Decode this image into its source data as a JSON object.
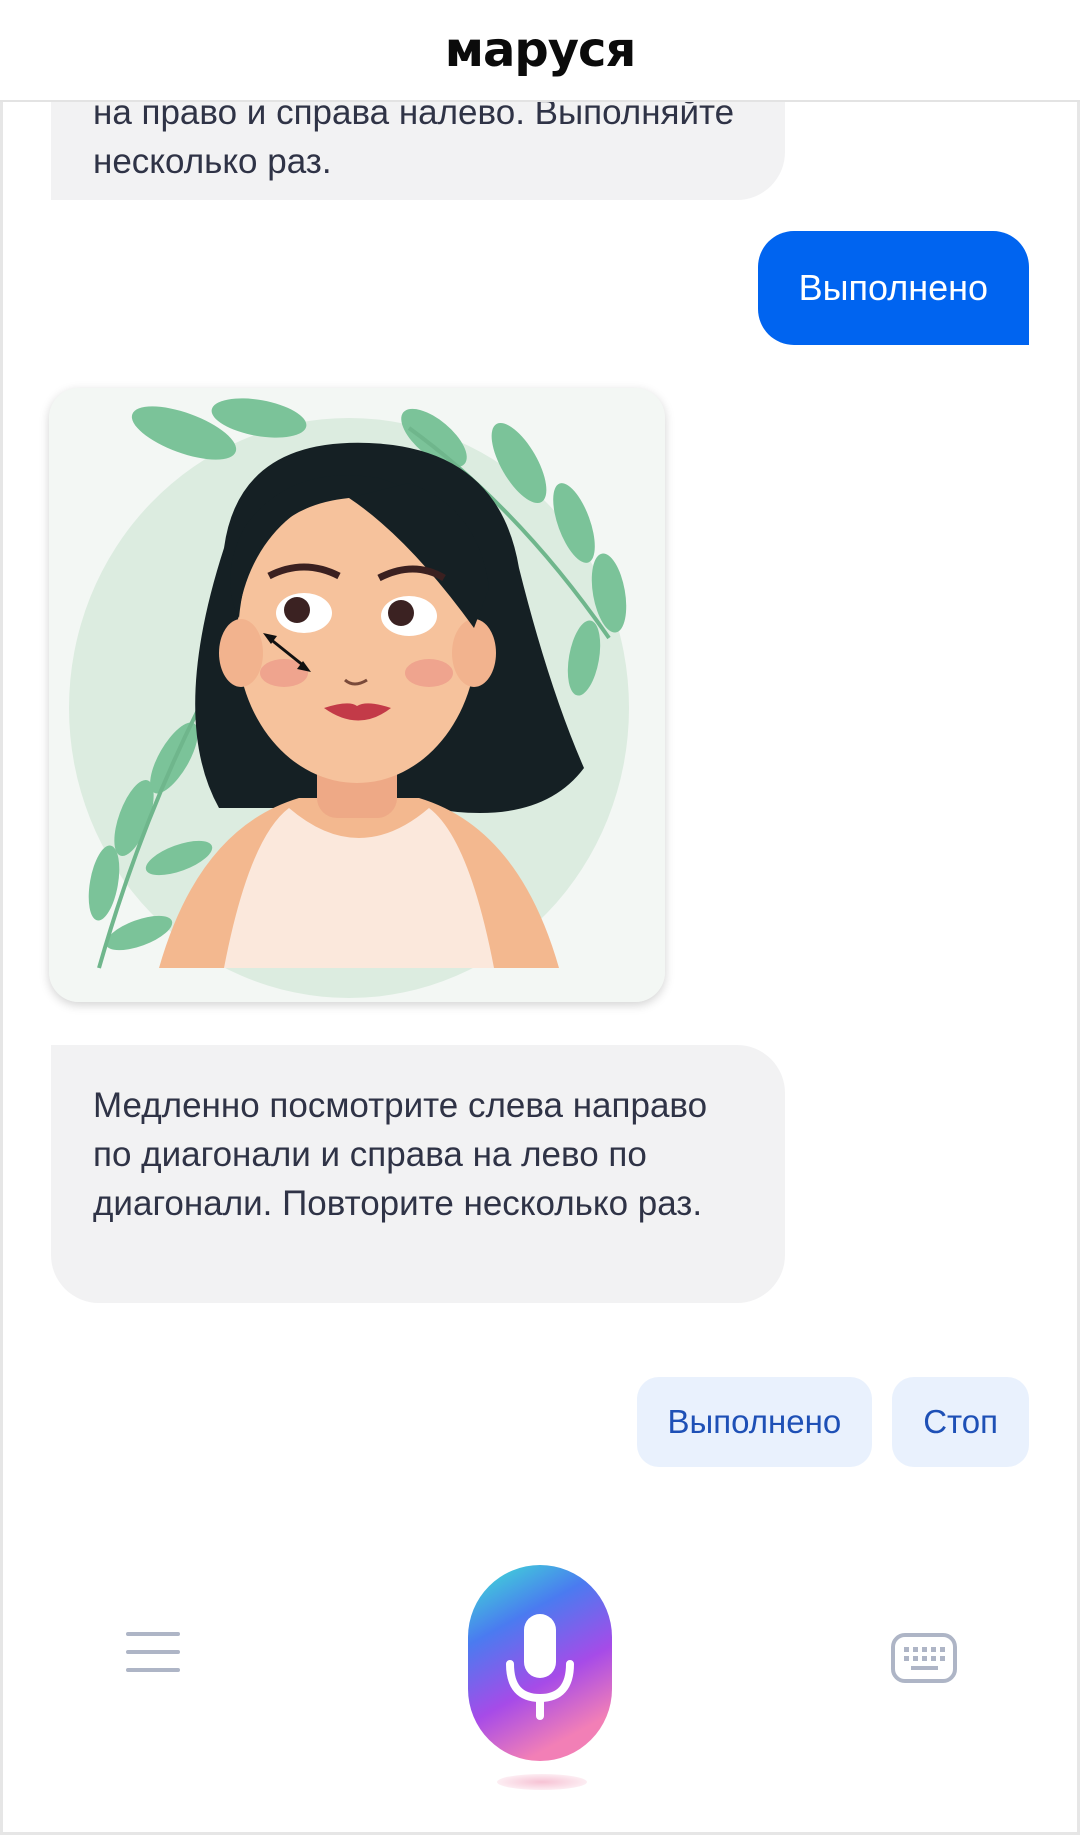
{
  "app": {
    "brand": "маруся"
  },
  "messages": {
    "prev_bot_partial": "на право и справа налево. Выполняйте несколько раз.",
    "user_reply": "Выполнено",
    "bot_text": "Медленно посмотрите слева направо по диагонали и справа на лево по диагонали. Повторите несколько раз."
  },
  "quick_replies": [
    "Выполнено",
    "Стоп"
  ],
  "icons": {
    "menu": "menu-icon",
    "mic": "microphone-icon",
    "keyboard": "keyboard-icon"
  },
  "colors": {
    "user_bubble": "#0064f0",
    "bot_bubble": "#f2f2f3",
    "chip_bg": "#e9f1fd",
    "chip_text": "#1e50b6"
  }
}
